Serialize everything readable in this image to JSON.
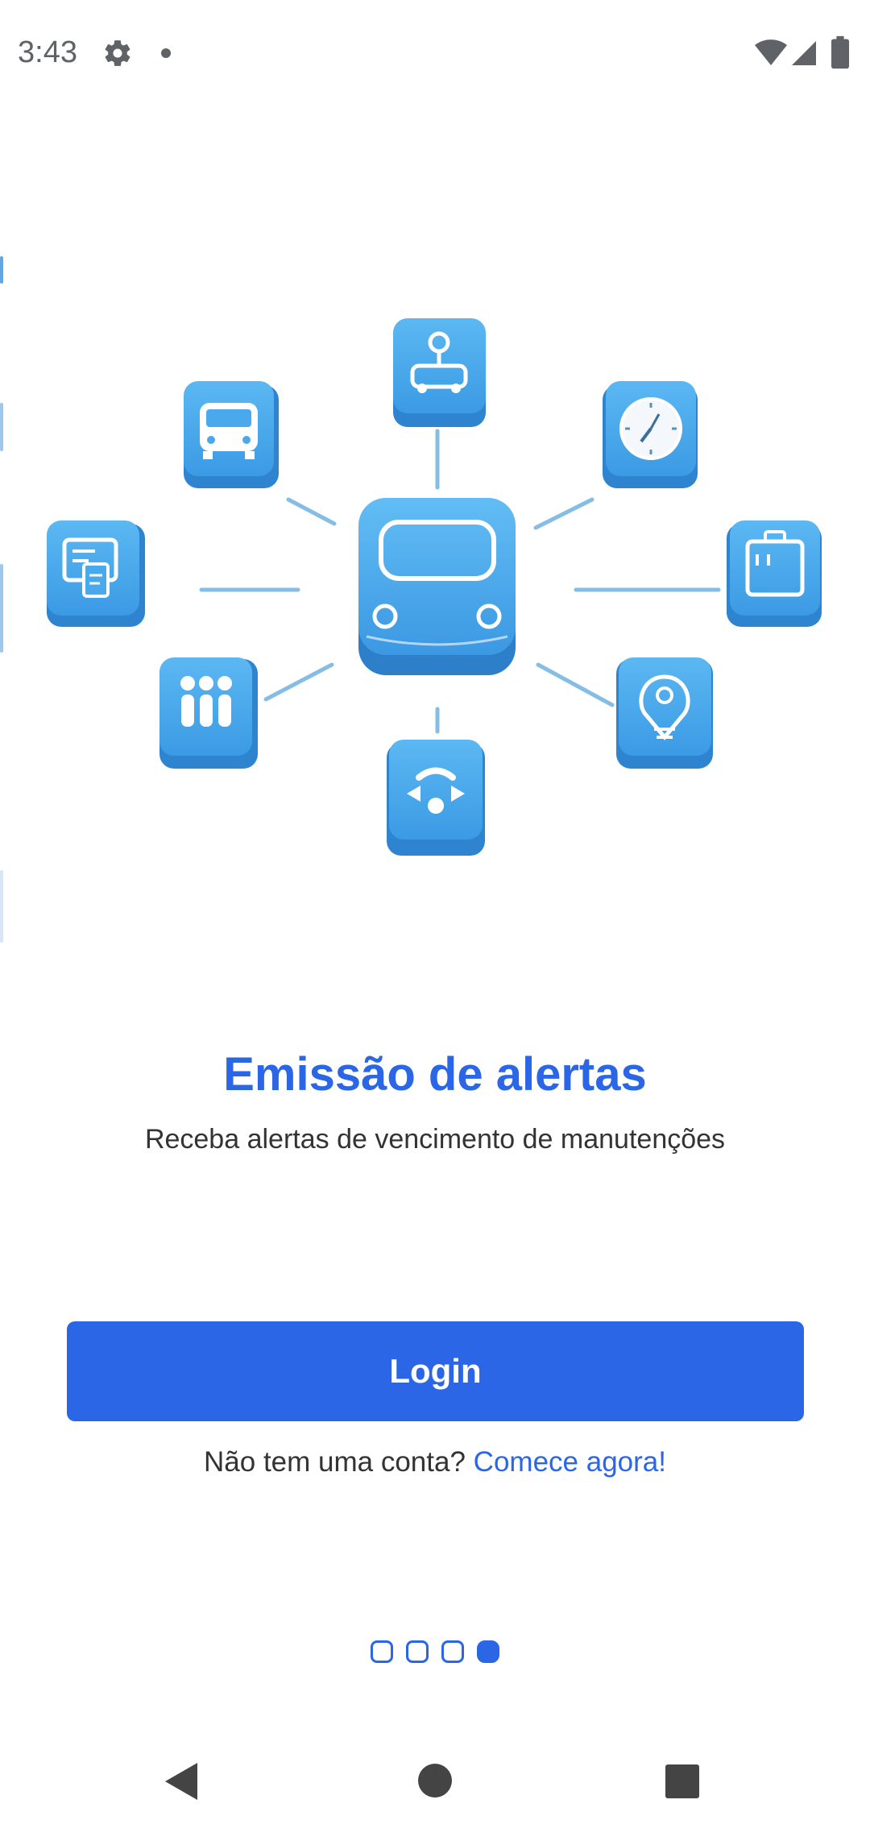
{
  "status_bar": {
    "time": "3:43",
    "icons": [
      "gear-icon",
      "notification-dot-icon",
      "wifi-icon",
      "signal-icon",
      "battery-icon"
    ]
  },
  "illustration": {
    "center": "car-icon",
    "tiles": [
      "map-pin-route-icon",
      "van-icon",
      "clock-icon",
      "document-icon",
      "toolbox-icon",
      "equalizer-icon",
      "location-target-icon",
      "steering-icon"
    ]
  },
  "onboarding": {
    "title": "Emissão de alertas",
    "subtitle": "Receba alertas de vencimento de manutenções"
  },
  "actions": {
    "login_label": "Login",
    "signup_prompt": "Não tem uma conta?",
    "signup_link": "Comece agora!"
  },
  "pager": {
    "total": 4,
    "active_index": 3
  },
  "colors": {
    "accent": "#2a66e6",
    "tile_blue": "#4aa8ec",
    "text": "#333333"
  }
}
